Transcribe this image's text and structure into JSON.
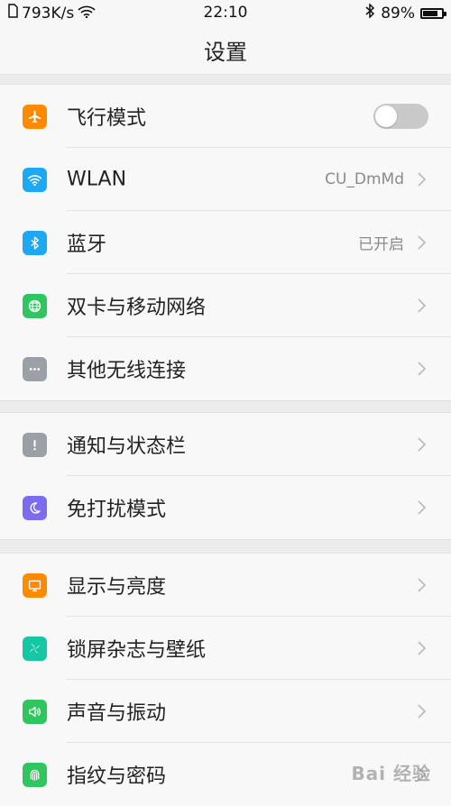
{
  "status_bar": {
    "speed": "793K/s",
    "time": "22:10",
    "battery": "89%",
    "battery_level": 0.89,
    "icons": [
      "sim-icon",
      "wifi-signal-icon",
      "bluetooth-icon",
      "battery-icon"
    ]
  },
  "header": {
    "title": "设置"
  },
  "sections": [
    [
      {
        "label": "飞行模式",
        "icon": "airplane-icon",
        "color": "#ff8a00",
        "control": "toggle",
        "toggle_on": false
      },
      {
        "label": "WLAN",
        "icon": "wifi-icon",
        "color": "#1ea7f2",
        "value": "CU_DmMd"
      },
      {
        "label": "蓝牙",
        "icon": "bluetooth-icon",
        "color": "#1ea7f2",
        "value": "已开启"
      },
      {
        "label": "双卡与移动网络",
        "icon": "globe-icon",
        "color": "#2fc55f"
      },
      {
        "label": "其他无线连接",
        "icon": "more-dots-icon",
        "color": "#9aa0a6"
      }
    ],
    [
      {
        "label": "通知与状态栏",
        "icon": "exclamation-icon",
        "color": "#9aa0a6"
      },
      {
        "label": "免打扰模式",
        "icon": "moon-icon",
        "color": "#7b6cf0"
      }
    ],
    [
      {
        "label": "显示与亮度",
        "icon": "monitor-icon",
        "color": "#ff8a00"
      },
      {
        "label": "锁屏杂志与壁纸",
        "icon": "pinwheel-icon",
        "color": "#16c6a4"
      },
      {
        "label": "声音与振动",
        "icon": "speaker-icon",
        "color": "#2fc55f"
      },
      {
        "label": "指纹与密码",
        "icon": "fingerprint-icon",
        "color": "#2fc55f"
      }
    ]
  ],
  "watermark": "Bai 经验"
}
